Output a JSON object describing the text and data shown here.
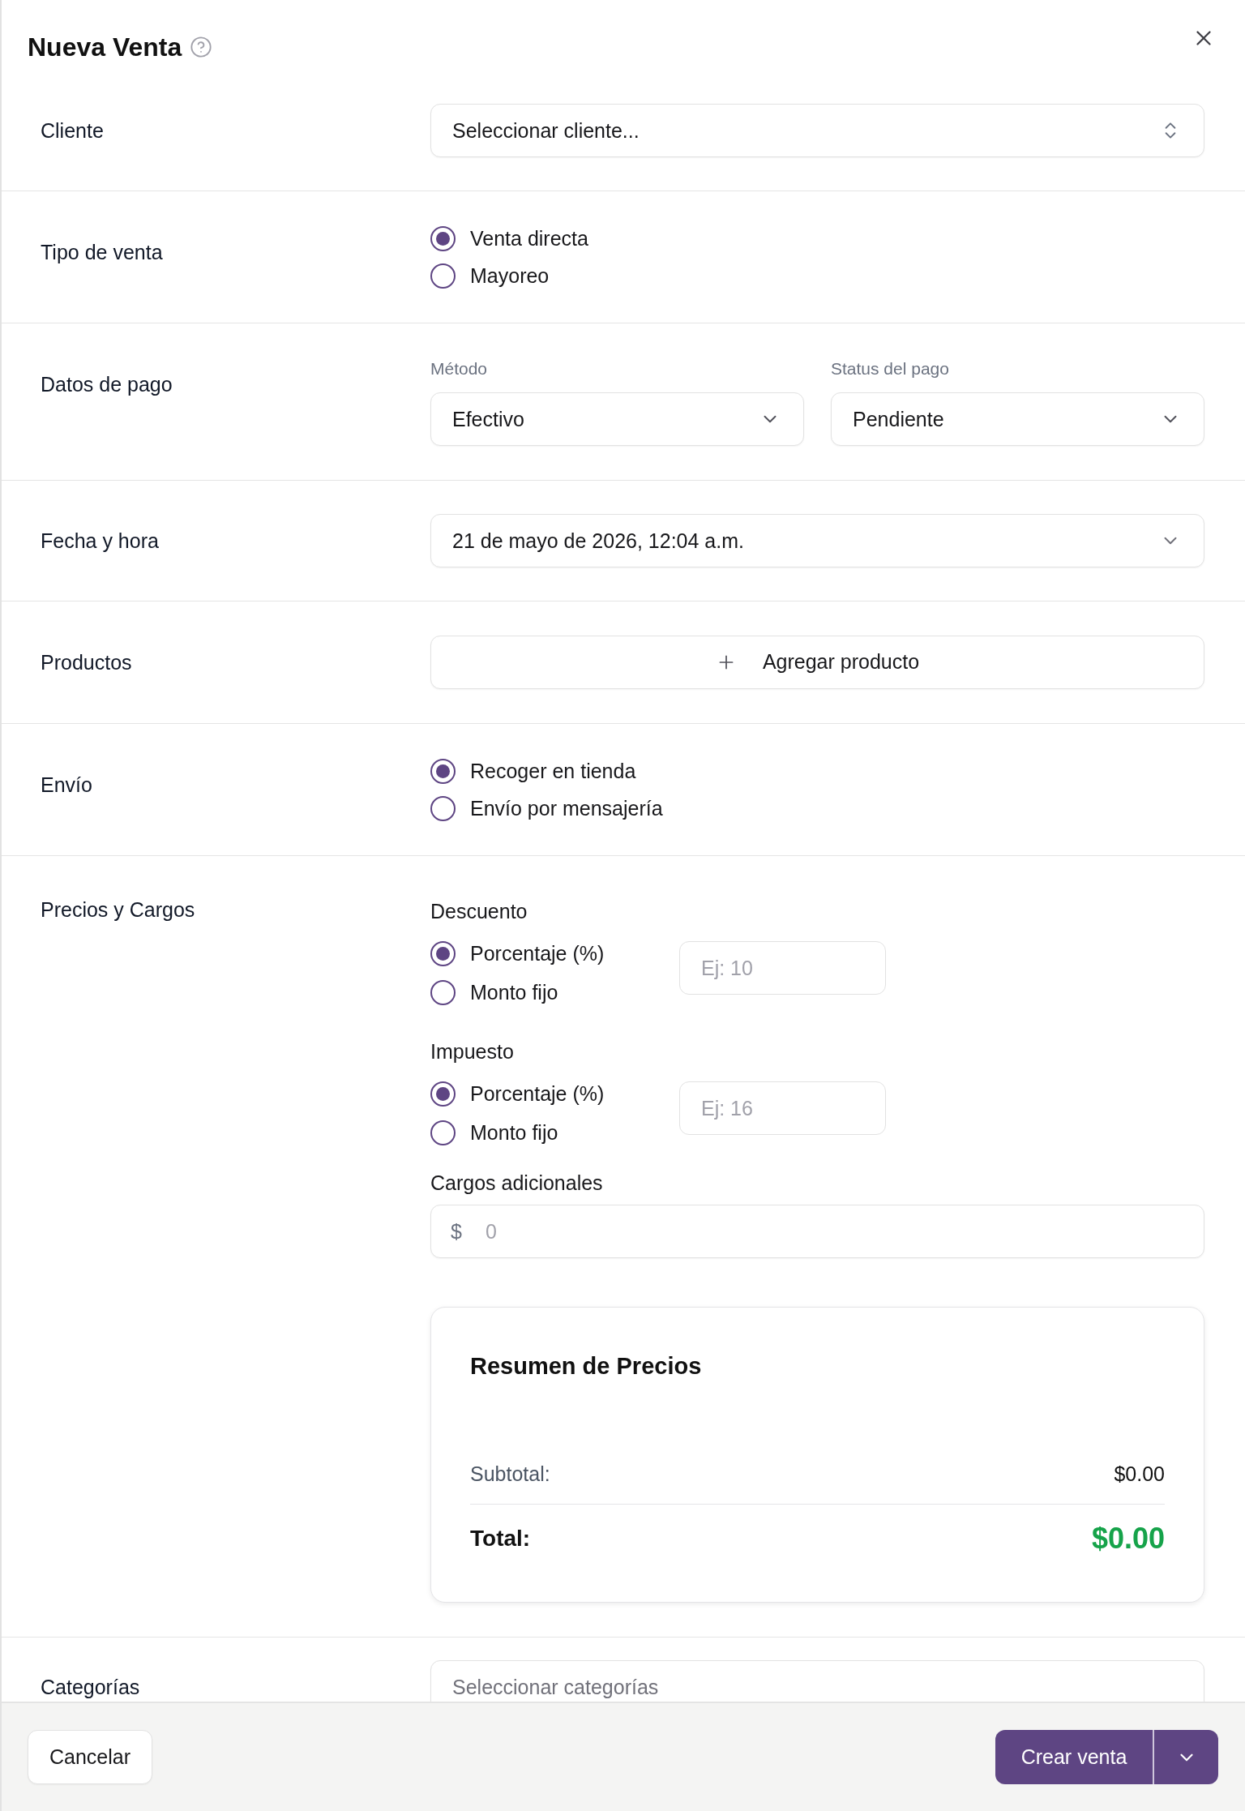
{
  "dialog": {
    "title": "Nueva Venta"
  },
  "sections": [
    {
      "kind": "combobox",
      "label": "Cliente",
      "value": "Seleccionar cliente..."
    },
    {
      "kind": "radio",
      "label": "Tipo de venta",
      "options": [
        {
          "label": "Venta directa",
          "selected": true
        },
        {
          "label": "Mayoreo",
          "selected": false
        }
      ]
    },
    {
      "kind": "selects",
      "label": "Datos de pago",
      "selects": [
        {
          "label": "Método",
          "value": "Efectivo"
        },
        {
          "label": "Status del pago",
          "value": "Pendiente"
        }
      ]
    },
    {
      "kind": "select",
      "label": "Fecha y hora",
      "value": "21 de mayo de 2026, 12:04 a.m."
    },
    {
      "kind": "add_button",
      "label": "Productos",
      "button": "Agregar producto"
    },
    {
      "kind": "radio",
      "label": "Envío",
      "options": [
        {
          "label": "Recoger en tienda",
          "selected": true
        },
        {
          "label": "Envío por mensajería",
          "selected": false
        }
      ]
    },
    {
      "kind": "pricing",
      "label": "Precios y Cargos",
      "groups": [
        {
          "title": "Descuento",
          "options": [
            {
              "label": "Porcentaje (%)",
              "selected": true
            },
            {
              "label": "Monto fijo",
              "selected": false
            }
          ],
          "placeholder": "Ej: 10"
        },
        {
          "title": "Impuesto",
          "options": [
            {
              "label": "Porcentaje (%)",
              "selected": true
            },
            {
              "label": "Monto fijo",
              "selected": false
            }
          ],
          "placeholder": "Ej: 16"
        }
      ],
      "extra_charges": {
        "label": "Cargos adicionales",
        "prefix": "$",
        "placeholder": "0"
      },
      "summary": {
        "title": "Resumen de Precios",
        "rows": [
          {
            "kind": "subtotal",
            "label": "Subtotal:",
            "value": "$0.00"
          },
          {
            "kind": "total",
            "label": "Total:",
            "value": "$0.00"
          }
        ]
      }
    },
    {
      "kind": "multiselect",
      "label": "Categorías",
      "placeholder": "Seleccionar categorías"
    }
  ],
  "footer": {
    "buttons": [
      {
        "kind": "secondary",
        "label": "Cancelar"
      },
      {
        "kind": "primary",
        "label": "Crear venta"
      }
    ]
  }
}
